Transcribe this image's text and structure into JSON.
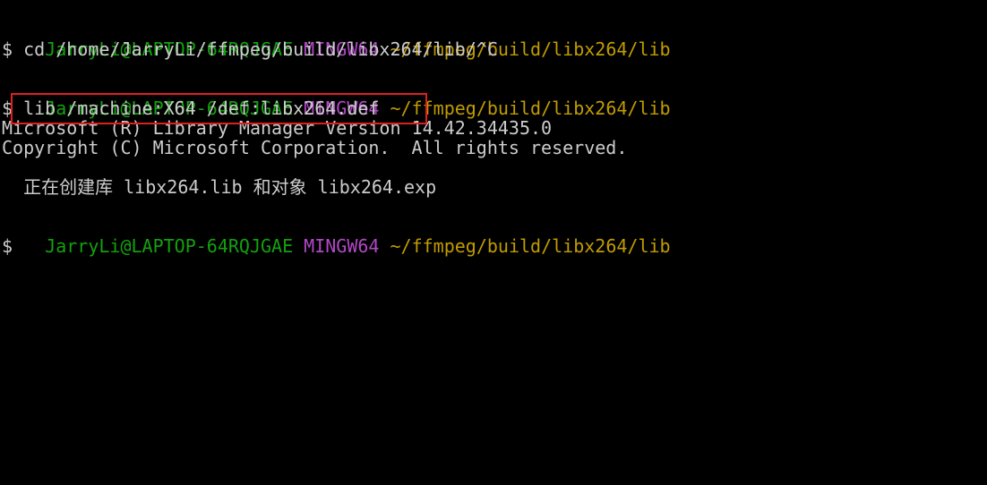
{
  "terminal": {
    "prompt1": {
      "user": "JarryLi@LAPTOP-64RQJGAE",
      "system": "MINGW64",
      "path": "~/ffmpeg/build/libx264/lib"
    },
    "cmd1": "$ cd /home/JarryLi/ffmpeg/build/libx264/lib/^C",
    "prompt2": {
      "user": "JarryLi@LAPTOP-64RQJGAE",
      "system": "MINGW64",
      "path": "~/ffmpeg/build/libx264/lib"
    },
    "cmd2": "$ lib /machine:X64 /def:libx264.def",
    "out1": "Microsoft (R) Library Manager Version 14.42.34435.0",
    "out2": "Copyright (C) Microsoft Corporation.  All rights reserved.",
    "out3": "  正在创建库 libx264.lib 和对象 libx264.exp",
    "prompt3": {
      "user": "JarryLi@LAPTOP-64RQJGAE",
      "system": "MINGW64",
      "path": "~/ffmpeg/build/libx264/lib"
    },
    "cmd3": "$"
  },
  "colors": {
    "user": "#13a10e",
    "system": "#b148c6",
    "path": "#c19c00",
    "text": "#cccccc",
    "highlight": "#e02020",
    "background": "#000000"
  }
}
